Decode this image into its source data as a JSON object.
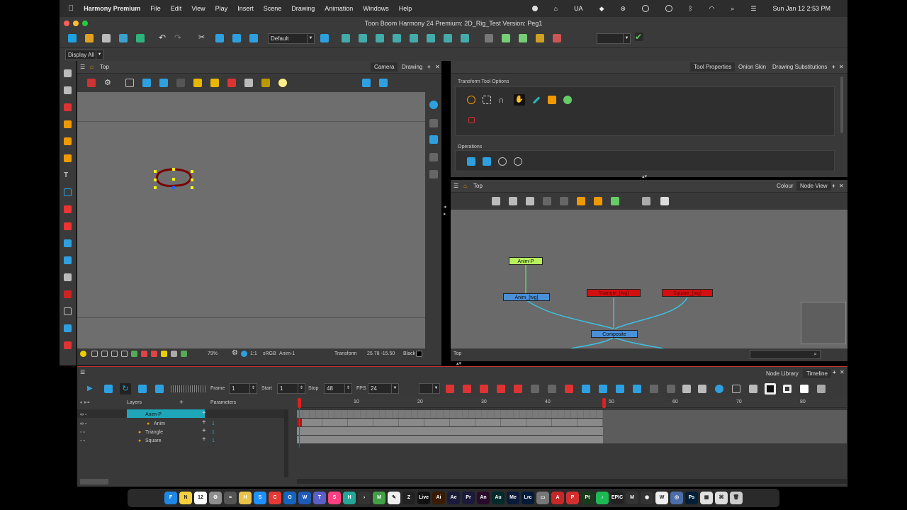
{
  "menubar": {
    "app": "Harmony Premium",
    "items": [
      "File",
      "Edit",
      "View",
      "Play",
      "Insert",
      "Scene",
      "Drawing",
      "Animation",
      "Windows",
      "Help"
    ],
    "input_source": "UA",
    "clock": "Sun Jan 12  2:53 PM"
  },
  "window": {
    "title": "Toon Boom Harmony 24 Premium: 2D_Rig_Test Version: Peg1"
  },
  "toolbar": {
    "workspace_select": "Default",
    "display_select": "Display All"
  },
  "camera_view": {
    "view_name": "Top",
    "tabs": [
      "Camera",
      "Drawing"
    ],
    "status": {
      "zoom": "79%",
      "ratio": "1:1",
      "color_space": "sRGB",
      "layer": "Anim-1",
      "tool": "Transform",
      "coords": "25.78 -15.50",
      "color_name": "Black"
    }
  },
  "tool_properties": {
    "tabs": [
      "Tool Properties",
      "Onion Skin",
      "Drawing Substitutions"
    ],
    "section_options": "Transform Tool Options",
    "section_operations": "Operations"
  },
  "node_view": {
    "view_name": "Top",
    "tabs": [
      "Colour",
      "Node View"
    ],
    "footer_label": "Top",
    "nodes": [
      {
        "label": "Anim-P"
      },
      {
        "label": "Anim_[tvg]"
      },
      {
        "label": "Triangle_[tvg]"
      },
      {
        "label": "Square_[tvg]"
      },
      {
        "label": "Composite"
      }
    ]
  },
  "timeline": {
    "tabs": [
      "Node Library",
      "Timeline"
    ],
    "frame_label": "Frame",
    "frame_value": "1",
    "start_label": "Start",
    "start_value": "1",
    "stop_label": "Stop",
    "stop_value": "48",
    "fps_label": "FPS",
    "fps_value": "24",
    "col_layers": "Layers",
    "col_params": "Parameters",
    "ruler": [
      "10",
      "20",
      "30",
      "40",
      "50",
      "60",
      "70",
      "80"
    ],
    "layers": [
      {
        "name": "Anim-P",
        "param": ""
      },
      {
        "name": "Anim",
        "param": "1"
      },
      {
        "name": "Triangle",
        "param": "1"
      },
      {
        "name": "Square",
        "param": "1"
      }
    ]
  },
  "dock": {
    "apps": [
      {
        "name": "Finder",
        "color": "#1e88e5",
        "glyph": "F"
      },
      {
        "name": "Notes",
        "color": "#f4d03f",
        "glyph": "N"
      },
      {
        "name": "Calendar",
        "color": "#ffffff",
        "glyph": "12"
      },
      {
        "name": "Settings",
        "color": "#8e8e8e",
        "glyph": "⚙"
      },
      {
        "name": "Calculator",
        "color": "#555555",
        "glyph": "="
      },
      {
        "name": "Harmony",
        "color": "#e8c34a",
        "glyph": "H"
      },
      {
        "name": "Safari",
        "color": "#1e90ff",
        "glyph": "S"
      },
      {
        "name": "Chrome",
        "color": "#e53935",
        "glyph": "C"
      },
      {
        "name": "Outlook",
        "color": "#1565c0",
        "glyph": "O"
      },
      {
        "name": "Word",
        "color": "#1e5bb8",
        "glyph": "W"
      },
      {
        "name": "Teams",
        "color": "#5b5fc7",
        "glyph": "T"
      },
      {
        "name": "Stage",
        "color": "#ff4081",
        "glyph": "S"
      },
      {
        "name": "Harmony2",
        "color": "#26a69a",
        "glyph": "H"
      },
      {
        "name": "Term",
        "color": "#333333",
        "glyph": "›"
      },
      {
        "name": "Mail",
        "color": "#43a047",
        "glyph": "M"
      },
      {
        "name": "Mural",
        "color": "#eeeeee",
        "glyph": "✎"
      },
      {
        "name": "Zoom",
        "color": "#222222",
        "glyph": "Z"
      },
      {
        "name": "Live",
        "color": "#111111",
        "glyph": "Live"
      },
      {
        "name": "Illustrator",
        "color": "#3a1a00",
        "glyph": "Ai"
      },
      {
        "name": "AfterEffects",
        "color": "#1a1a3a",
        "glyph": "Ae"
      },
      {
        "name": "Premiere",
        "color": "#1a1a3a",
        "glyph": "Pr"
      },
      {
        "name": "Animate",
        "color": "#2a0a2a",
        "glyph": "An"
      },
      {
        "name": "Audition",
        "color": "#002a2a",
        "glyph": "Au"
      },
      {
        "name": "MediaEncoder",
        "color": "#0a1a3a",
        "glyph": "Me"
      },
      {
        "name": "Lightroom",
        "color": "#001a3a",
        "glyph": "Lrc"
      },
      {
        "name": "Camera",
        "color": "#777777",
        "glyph": "▭"
      },
      {
        "name": "Acrobat",
        "color": "#c62828",
        "glyph": "A"
      },
      {
        "name": "Pinterest",
        "color": "#d32f2f",
        "glyph": "P"
      },
      {
        "name": "Pt",
        "color": "#1b3a1b",
        "glyph": "Pt"
      },
      {
        "name": "Spotify",
        "color": "#1db954",
        "glyph": "♪"
      },
      {
        "name": "Epic",
        "color": "#222222",
        "glyph": "EPIC"
      },
      {
        "name": "Gmail",
        "color": "#333333",
        "glyph": "M"
      },
      {
        "name": "Blender",
        "color": "#333333",
        "glyph": "◉"
      },
      {
        "name": "WhatsApp",
        "color": "#eeeeee",
        "glyph": "W"
      },
      {
        "name": "Preview",
        "color": "#4b6ea9",
        "glyph": "◎"
      },
      {
        "name": "Photoshop",
        "color": "#001e36",
        "glyph": "Ps"
      },
      {
        "name": "Finder2",
        "color": "#e0e0e0",
        "glyph": "▦"
      },
      {
        "name": "Script",
        "color": "#dddddd",
        "glyph": "⌘"
      },
      {
        "name": "Trash",
        "color": "#cccccc",
        "glyph": "🗑"
      }
    ]
  }
}
